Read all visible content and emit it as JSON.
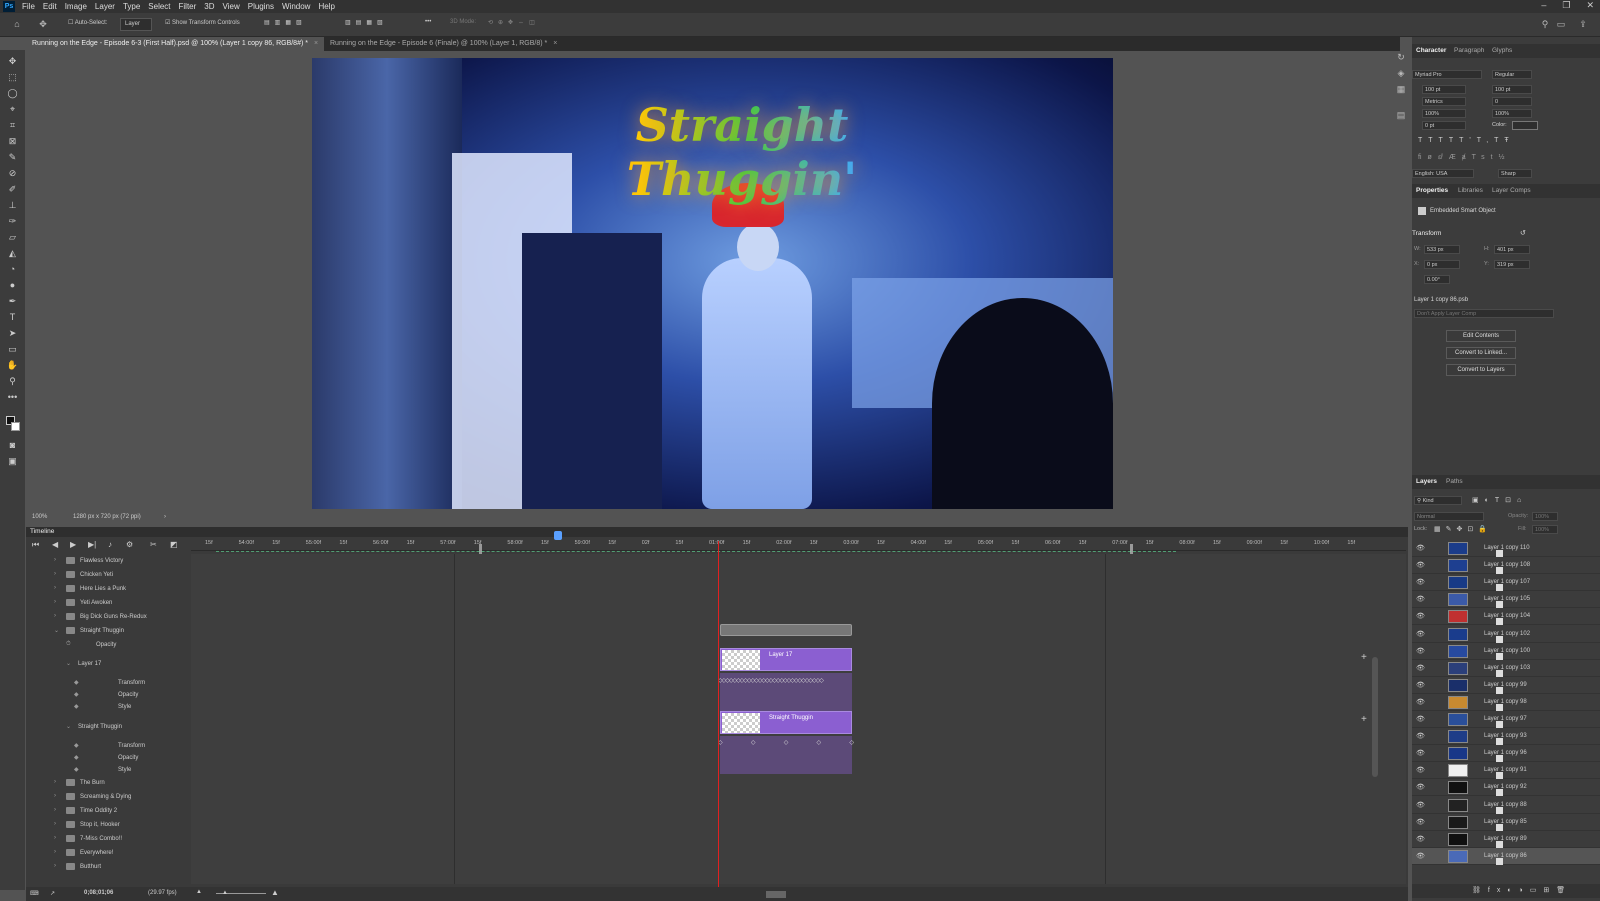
{
  "app": {
    "logo": "Ps",
    "menu": [
      "File",
      "Edit",
      "Image",
      "Layer",
      "Type",
      "Select",
      "Filter",
      "3D",
      "View",
      "Plugins",
      "Window",
      "Help"
    ]
  },
  "options": {
    "auto_select": "Auto-Select:",
    "layer_select": "Layer",
    "transform": "Show Transform Controls",
    "mode3d": "3D Mode:"
  },
  "tabs": [
    {
      "label": "Running on the Edge - Episode 6-3 (First Half).psd @ 100% (Layer 1 copy 86, RGB/8#) *"
    },
    {
      "label": "Running on the Edge - Episode 6 (Finale) @ 100% (Layer 1, RGB/8) *"
    }
  ],
  "canvas": {
    "title_text": "Straight Thuggin'"
  },
  "status": {
    "zoom": "100%",
    "doc": "1280 px x 720 px (72 ppi)"
  },
  "timeline": {
    "title": "Timeline",
    "ruler": [
      "15f",
      "54:00f",
      "15f",
      "55:00f",
      "15f",
      "56:00f",
      "15f",
      "57:00f",
      "15f",
      "58:00f",
      "15f",
      "59:00f",
      "15f",
      "02f",
      "15f",
      "01:00f",
      "15f",
      "02:00f",
      "15f",
      "03:00f",
      "15f",
      "04:00f",
      "15f",
      "05:00f",
      "15f",
      "06:00f",
      "15f",
      "07:00f",
      "15f",
      "08:00f",
      "15f",
      "09:00f",
      "15f",
      "10:00f",
      "15f"
    ],
    "tracks": [
      "Flawless Victory",
      "Chicken Yeti",
      "Here Lies a Punk",
      "Yeti Awoken",
      "Big Dick Guns Re-Redux",
      "Straight Thuggin",
      "Opacity",
      "Layer 17",
      "Transform",
      "Opacity",
      "Style",
      "Straight Thuggin",
      "Transform",
      "Opacity",
      "Style",
      "The Burn",
      "Screaming & Dying",
      "Time Oddity 2",
      "Stop it, Hooker",
      "7-Miss Combo!!",
      "Everywhere!",
      "Butthurt"
    ],
    "clips": {
      "layer17": "Layer 17",
      "thuggin": "Straight Thuggin"
    },
    "timecode": "0;08;01;06",
    "fps": "(29.97 fps)"
  },
  "character": {
    "tabs": [
      "Character",
      "Paragraph",
      "Glyphs"
    ],
    "font": "Myriad Pro",
    "style": "Regular",
    "size": "100 pt",
    "leading": "100 pt",
    "kerning": "Metrics",
    "tracking": "0",
    "vscale": "100%",
    "hscale": "100%",
    "baseline": "0 pt",
    "color_label": "Color:",
    "language": "English: USA",
    "aa": "Sharp"
  },
  "properties": {
    "tabs": [
      "Properties",
      "Libraries",
      "Layer Comps"
    ],
    "type": "Embedded Smart Object",
    "section": "Transform",
    "w_label": "W:",
    "w": "533 px",
    "h_label": "H:",
    "h": "401 px",
    "x_label": "X:",
    "x": "0 px",
    "y_label": "Y:",
    "y": "319 px",
    "angle": "0.00°",
    "file": "Layer 1 copy 86.psb",
    "comp": "Don't Apply Layer Comp",
    "buttons": [
      "Edit Contents",
      "Convert to Linked...",
      "Convert to Layers"
    ]
  },
  "layers": {
    "tabs": [
      "Layers",
      "Paths"
    ],
    "kind": "Kind",
    "blend": "Normal",
    "opacity_label": "Opacity:",
    "opacity": "100%",
    "lock_label": "Lock:",
    "fill_label": "Fill:",
    "fill": "100%",
    "items": [
      "Layer 1 copy 110",
      "Layer 1 copy 108",
      "Layer 1 copy 107",
      "Layer 1 copy 105",
      "Layer 1 copy 104",
      "Layer 1 copy 102",
      "Layer 1 copy 100",
      "Layer 1 copy 103",
      "Layer 1 copy 99",
      "Layer 1 copy 98",
      "Layer 1 copy 97",
      "Layer 1 copy 93",
      "Layer 1 copy 96",
      "Layer 1 copy 91",
      "Layer 1 copy 92",
      "Layer 1 copy 88",
      "Layer 1 copy 85",
      "Layer 1 copy 89",
      "Layer 1 copy 86"
    ]
  }
}
